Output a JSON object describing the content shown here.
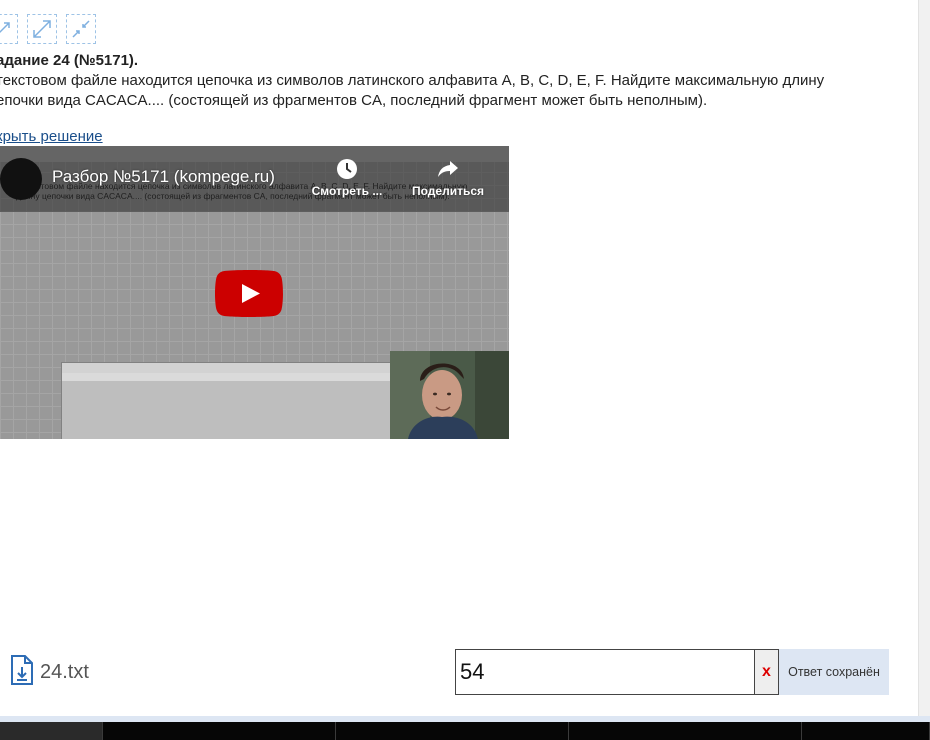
{
  "task": {
    "title": "адание 24 (№5171).",
    "text_line1": " текстовом файле находится цепочка из символов латинского алфавита A, B, C, D, E, F. Найдите максимальную длину",
    "text_line2": "епочки вида CACACA.... (состоящей из фрагментов CA, последний фрагмент может быть неполным).",
    "solution_link": "крыть решение"
  },
  "video": {
    "title": "Разбор №5171 (kompege.ru)",
    "watch_later_label": "Смотреть ...",
    "share_label": "Поделиться",
    "embedded_task_text": "В текстовом файле находится цепочка из символов латинского алфавита A, B, C, D, E, F. Найдите максимальную длину цепочки вида CACACA.... (состоящей из фрагментов CA, последний фрагмент может быть неполным).",
    "play_color": "#cc0000"
  },
  "file": {
    "name": "24.txt"
  },
  "answer": {
    "value": "54",
    "clear_label": "x",
    "status": "Ответ сохранён"
  },
  "colors": {
    "link": "#1a4e8a",
    "status_bg": "#dde6f3",
    "icon": "#2d6cb5"
  }
}
